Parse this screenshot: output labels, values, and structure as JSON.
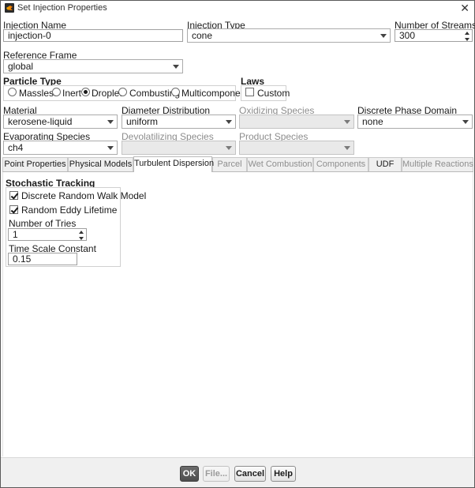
{
  "window": {
    "title": "Set Injection Properties",
    "close_glyph": "✕"
  },
  "injection_name": {
    "label": "Injection Name",
    "value": "injection-0"
  },
  "injection_type": {
    "label": "Injection Type",
    "value": "cone"
  },
  "number_of_streams": {
    "label": "Number of Streams",
    "value": "300"
  },
  "reference_frame": {
    "label": "Reference Frame",
    "value": "global"
  },
  "particle_type": {
    "label": "Particle Type",
    "options": [
      {
        "label": "Massless",
        "selected": false
      },
      {
        "label": "Inert",
        "selected": false
      },
      {
        "label": "Droplet",
        "selected": true
      },
      {
        "label": "Combusting",
        "selected": false
      },
      {
        "label": "Multicomponent",
        "selected": false
      }
    ]
  },
  "laws": {
    "label": "Laws",
    "custom_label": "Custom",
    "custom_checked": false
  },
  "material": {
    "label": "Material",
    "value": "kerosene-liquid"
  },
  "diameter_distribution": {
    "label": "Diameter Distribution",
    "value": "uniform"
  },
  "oxidizing_species": {
    "label": "Oxidizing Species",
    "value": ""
  },
  "discrete_phase_domain": {
    "label": "Discrete Phase Domain",
    "value": "none"
  },
  "evaporating_species": {
    "label": "Evaporating Species",
    "value": "ch4"
  },
  "devolatilizing_species": {
    "label": "Devolatilizing Species",
    "value": ""
  },
  "product_species": {
    "label": "Product Species",
    "value": ""
  },
  "tabs": [
    {
      "label": "Point Properties",
      "enabled": true,
      "active": false
    },
    {
      "label": "Physical Models",
      "enabled": true,
      "active": false
    },
    {
      "label": "Turbulent Dispersion",
      "enabled": true,
      "active": true
    },
    {
      "label": "Parcel",
      "enabled": false,
      "active": false
    },
    {
      "label": "Wet Combustion",
      "enabled": false,
      "active": false
    },
    {
      "label": "Components",
      "enabled": false,
      "active": false
    },
    {
      "label": "UDF",
      "enabled": true,
      "active": false
    },
    {
      "label": "Multiple Reactions",
      "enabled": false,
      "active": false
    }
  ],
  "stochastic_tracking": {
    "title": "Stochastic Tracking",
    "discrete_random_walk": {
      "label": "Discrete Random Walk Model",
      "checked": true
    },
    "random_eddy_lifetime": {
      "label": "Random Eddy Lifetime",
      "checked": true
    },
    "number_of_tries": {
      "label": "Number of Tries",
      "value": "1"
    },
    "time_scale_constant": {
      "label": "Time Scale Constant",
      "value": "0.15"
    }
  },
  "buttons": {
    "ok": "OK",
    "file": "File...",
    "cancel": "Cancel",
    "help": "Help"
  }
}
